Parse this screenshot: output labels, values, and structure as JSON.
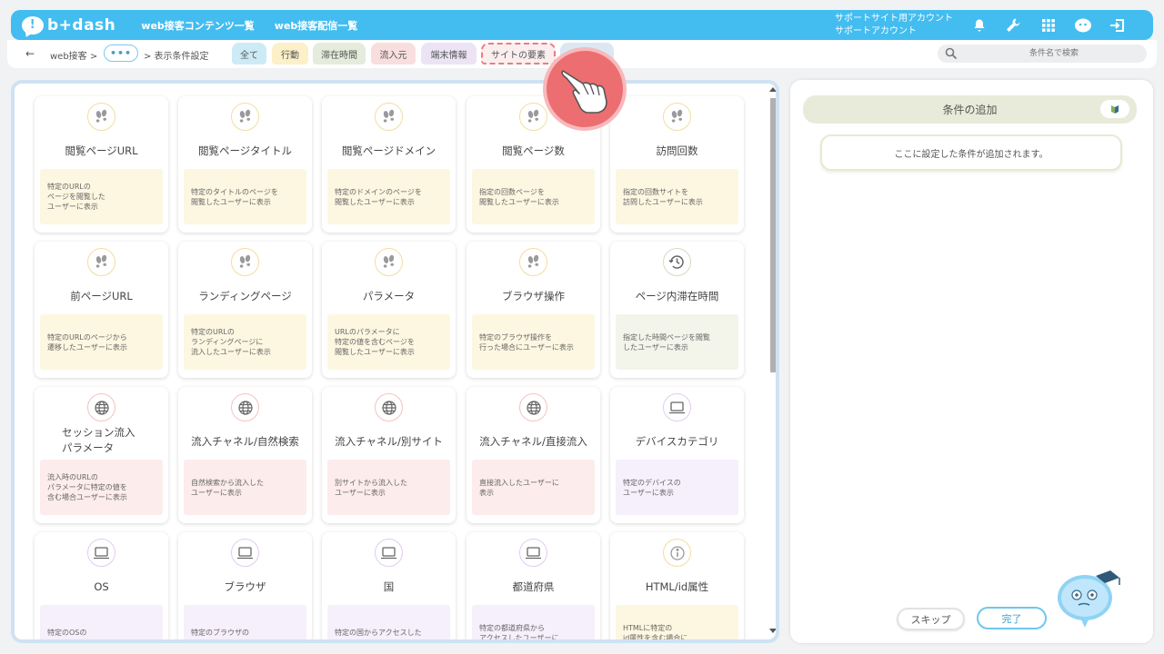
{
  "header": {
    "logo_text": "b+dash",
    "nav": [
      "web接客コンテンツ一覧",
      "web接客配信一覧"
    ],
    "account_line1": "サポートサイト用アカウント",
    "account_line2": "サポートアカウント",
    "icons": [
      "bell-icon",
      "wrench-icon",
      "grid-icon",
      "mascot-icon",
      "logout-icon"
    ]
  },
  "toolbar": {
    "back": "←",
    "crumb1": "web接客 >",
    "dots": "•••",
    "crumb2": "> 表示条件設定",
    "tabs": [
      {
        "label": "全て",
        "bg": "#cdebf6"
      },
      {
        "label": "行動",
        "bg": "#fbf0c8"
      },
      {
        "label": "滞在時間",
        "bg": "#e5ecdc"
      },
      {
        "label": "流入元",
        "bg": "#f9dede"
      },
      {
        "label": "端末情報",
        "bg": "#ece4f5"
      },
      {
        "label": "サイトの要素",
        "bg": "#fbeeee"
      },
      {
        "label": "",
        "bg": "#dbe8f2"
      }
    ],
    "search_placeholder": "条件名で検索"
  },
  "cards": [
    {
      "title": "閲覧ページURL",
      "desc": "特定のURLの\nページを閲覧した\nユーザーに表示",
      "icon": "footprints-icon",
      "theme": "yellow"
    },
    {
      "title": "閲覧ページタイトル",
      "desc": "特定のタイトルのページを\n閲覧したユーザーに表示",
      "icon": "footprints-icon",
      "theme": "yellow"
    },
    {
      "title": "閲覧ページドメイン",
      "desc": "特定のドメインのページを\n閲覧したユーザーに表示",
      "icon": "footprints-icon",
      "theme": "yellow"
    },
    {
      "title": "閲覧ページ数",
      "desc": "指定の回数ページを\n閲覧したユーザーに表示",
      "icon": "footprints-icon",
      "theme": "yellow"
    },
    {
      "title": "訪問回数",
      "desc": "指定の回数サイトを\n訪問したユーザーに表示",
      "icon": "footprints-icon",
      "theme": "yellow"
    },
    {
      "title": "前ページURL",
      "desc": "特定のURLのページから\n遷移したユーザーに表示",
      "icon": "footprints-icon",
      "theme": "yellow"
    },
    {
      "title": "ランディングページ",
      "desc": "特定のURLの\nランディングページに\n流入したユーザーに表示",
      "icon": "footprints-icon",
      "theme": "yellow"
    },
    {
      "title": "パラメータ",
      "desc": "URLのパラメータに\n特定の値を含むページを\n閲覧したユーザーに表示",
      "icon": "footprints-icon",
      "theme": "yellow"
    },
    {
      "title": "ブラウザ操作",
      "desc": "特定のブラウザ操作を\n行った場合にユーザーに表示",
      "icon": "footprints-icon",
      "theme": "yellow"
    },
    {
      "title": "ページ内滞在時間",
      "desc": "指定した時間ページを閲覧\nしたユーザーに表示",
      "icon": "clock-icon",
      "theme": "green"
    },
    {
      "title": "セッション流入\nパラメータ",
      "desc": "流入時のURLの\nパラメータに特定の値を\n含む場合ユーザーに表示",
      "icon": "globe-icon",
      "theme": "pink"
    },
    {
      "title": "流入チャネル/自然検索",
      "desc": "自然検索から流入した\nユーザーに表示",
      "icon": "globe-icon",
      "theme": "pink"
    },
    {
      "title": "流入チャネル/別サイト",
      "desc": "別サイトから流入した\nユーザーに表示",
      "icon": "globe-icon",
      "theme": "pink"
    },
    {
      "title": "流入チャネル/直接流入",
      "desc": "直接流入したユーザーに\n表示",
      "icon": "globe-icon",
      "theme": "pink"
    },
    {
      "title": "デバイスカテゴリ",
      "desc": "特定のデバイスの\nユーザーに表示",
      "icon": "laptop-icon",
      "theme": "purple"
    },
    {
      "title": "OS",
      "desc": "特定のOSの",
      "icon": "laptop-icon",
      "theme": "purple"
    },
    {
      "title": "ブラウザ",
      "desc": "特定のブラウザの",
      "icon": "laptop-icon",
      "theme": "purple"
    },
    {
      "title": "国",
      "desc": "特定の国からアクセスした",
      "icon": "laptop-icon",
      "theme": "purple"
    },
    {
      "title": "都道府県",
      "desc": "特定の都道府県から\nアクセスしたユーザーに",
      "icon": "laptop-icon",
      "theme": "purple"
    },
    {
      "title": "HTML/id属性",
      "desc": "HTMLに特定の\nid属性を含む場合に",
      "icon": "info-icon",
      "theme": "yellow"
    }
  ],
  "themes": {
    "yellow": {
      "desc_bg": "#fdf7e1",
      "ring": "#f6dca0",
      "icon": "#9a9a9a"
    },
    "green": {
      "desc_bg": "#f3f4ea",
      "ring": "#d4dcc0",
      "icon": "#666"
    },
    "pink": {
      "desc_bg": "#fdecec",
      "ring": "#f2c3c3",
      "icon": "#666"
    },
    "purple": {
      "desc_bg": "#f6effc",
      "ring": "#e0cdf0",
      "icon": "#666"
    }
  },
  "right_panel": {
    "add_title": "条件の追加",
    "drop_hint": "ここに設定した条件が追加されます。",
    "skip": "スキップ",
    "done": "完了"
  },
  "colors": {
    "accent": "#43bdf0",
    "pointer": "#ec6e71"
  }
}
